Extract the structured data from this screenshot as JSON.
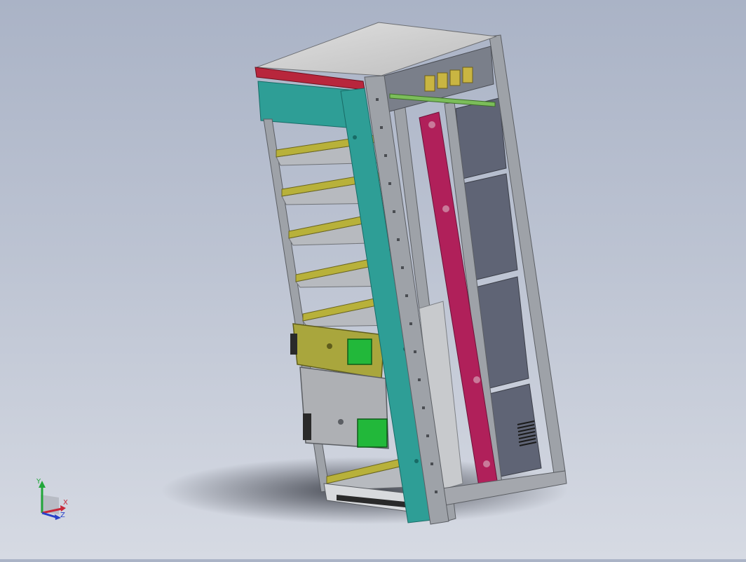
{
  "colors": {
    "background_top": "#aab3c6",
    "background_bottom": "#d6dae3",
    "frame": "#9ea2a8",
    "panel_teal": "#2e9e96",
    "panel_red": "#b8263c",
    "busbar_magenta": "#b0205a",
    "rail_yellow": "#b8b13a",
    "module_olive": "#a9a63d",
    "screen_green": "#22b83a",
    "enclosure_gray": "#5f6475",
    "top_plate": "#d2d2d2"
  },
  "triad": {
    "y_label": "Y",
    "x_label": "X",
    "z_label": "Z",
    "icon": "coordinate-triad-icon"
  },
  "model": {
    "shelf_count": 6,
    "icon": "switchgear-cabinet-3d-model"
  }
}
